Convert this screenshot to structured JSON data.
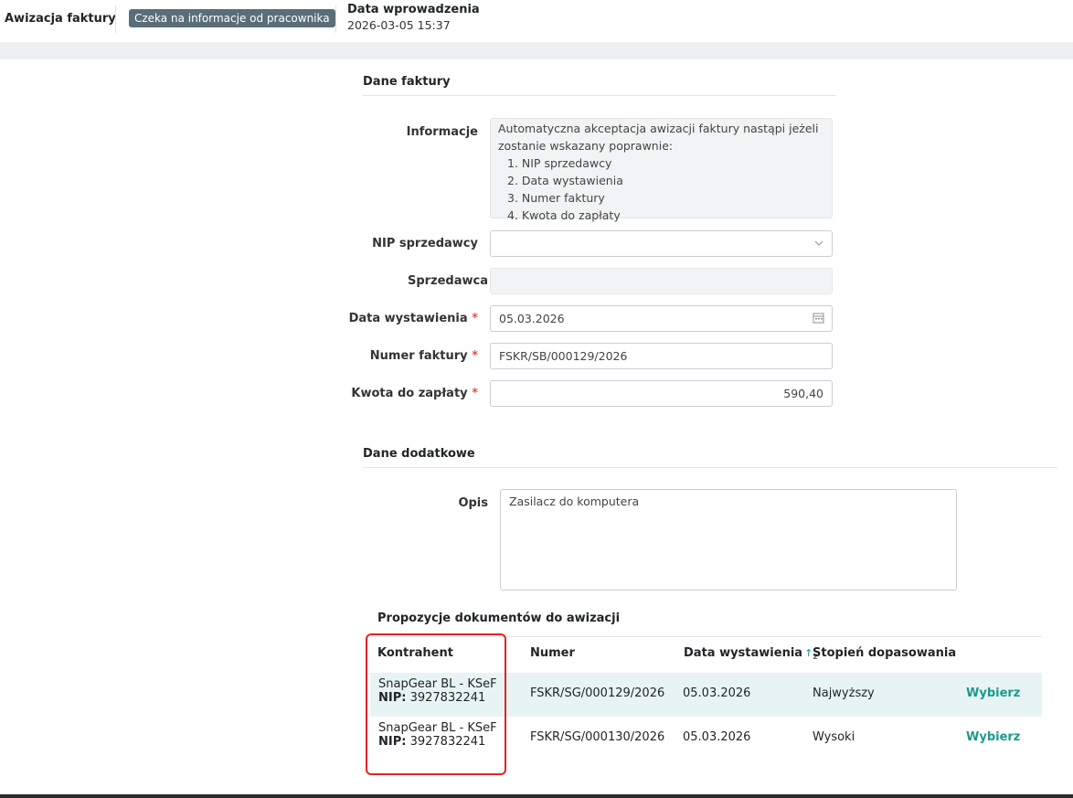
{
  "header": {
    "title": "Awizacja faktury",
    "status_badge": "Czeka na informacje od pracownika",
    "date_label": "Data wprowadzenia",
    "date_value": "2026-03-05 15:37"
  },
  "invoice_section": {
    "title": "Dane faktury",
    "info_label": "Informacje",
    "info_intro": "Automatyczna akceptacja awizacji faktury nastąpi jeżeli zostanie wskazany poprawnie:",
    "info_items": [
      "1. NIP sprzedawcy",
      "2. Data wystawienia",
      "3. Numer faktury",
      "4. Kwota do zapłaty"
    ],
    "nip_label": "NIP sprzedawcy",
    "nip_value": "",
    "seller_label": "Sprzedawca",
    "seller_value": "",
    "issue_date_label": "Data wystawienia",
    "issue_date_value": "05.03.2026",
    "invoice_number_label": "Numer faktury",
    "invoice_number_value": "FSKR/SB/000129/2026",
    "amount_label": "Kwota do zapłaty",
    "amount_value": "590,40",
    "required_mark": "*"
  },
  "additional_section": {
    "title": "Dane dodatkowe",
    "description_label": "Opis",
    "description_value": "Zasilacz do komputera"
  },
  "proposals": {
    "title": "Propozycje dokumentów do awizacji",
    "columns": [
      "Kontrahent",
      "Numer",
      "Data wystawienia",
      "Stopień dopasowania"
    ],
    "sort_indicator": "↑",
    "sort_order": "2",
    "nip_prefix": "NIP:",
    "rows": [
      {
        "contractor": "SnapGear BL - KSeF",
        "nip": "3927832241",
        "number": "FSKR/SG/000129/2026",
        "date": "05.03.2026",
        "match": "Najwyższy",
        "action": "Wybierz",
        "highlighted": true
      },
      {
        "contractor": "SnapGear BL - KSeF",
        "nip": "3927832241",
        "number": "FSKR/SG/000130/2026",
        "date": "05.03.2026",
        "match": "Wysoki",
        "action": "Wybierz",
        "highlighted": false
      }
    ]
  },
  "colors": {
    "badge_bg": "#5a6e79",
    "link": "#1a9a8a",
    "highlight_row": "#e8f4f4",
    "required": "#d9534f",
    "annotation_box": "#e02424"
  },
  "icons": {
    "nip_dropdown": "chevron-down-icon",
    "date_picker": "calendar-icon",
    "sort": "sort-ascending-icon"
  }
}
